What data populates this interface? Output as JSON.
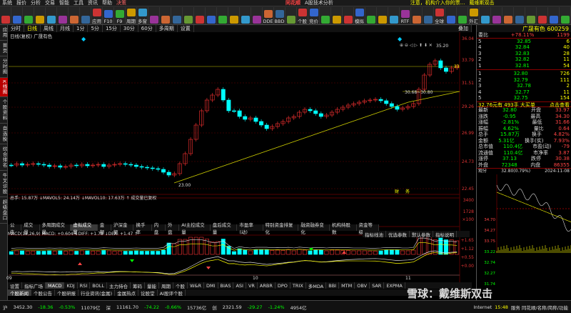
{
  "menu": {
    "items": [
      "系统",
      "报价",
      "分析",
      "交易",
      "智能",
      "工具",
      "资讯",
      "帮助",
      "决策"
    ],
    "brand": "同花顺",
    "subtitle": "A股技术分析",
    "notice": "注意，机构介入你的票...",
    "notice_link": "戴维斯双击"
  },
  "toolbar": {
    "buttons": [
      "",
      "",
      "",
      "",
      "",
      "",
      "",
      "",
      "应用",
      "F10",
      "F9",
      "周期",
      "多窗",
      "",
      "",
      "",
      "",
      "",
      "",
      "",
      "",
      "",
      "",
      "DDE",
      "BBD",
      "",
      "个股",
      "竞价",
      "",
      "",
      "",
      "模拟",
      "",
      "",
      "",
      "RTF",
      "",
      "",
      "全球",
      "",
      "",
      "外汇",
      "",
      "",
      "",
      "",
      "",
      "",
      "",
      ""
    ]
  },
  "sidebar": {
    "items": [
      "应用",
      "首页",
      "分时图",
      "K线图",
      "个股资料",
      "自选股",
      "综合排名",
      "牛叉诊股",
      "超级盘口"
    ],
    "active_index": 3
  },
  "periodbar": {
    "items": [
      "分时",
      "日线",
      "周线",
      "月线",
      "1分",
      "5分",
      "15分",
      "30分",
      "60分",
      "多周期",
      "设置"
    ],
    "selected_index": 1,
    "right_label": "叠加"
  },
  "chart": {
    "header": "日线(复权) 广晟有色",
    "axis_labels": [
      "36.04",
      "33.79",
      "31.51",
      "29.26",
      "26.99",
      "24.73",
      "22.45"
    ],
    "high_label": "35.20",
    "low_label": "23.00",
    "box_label": "30.68~30.80",
    "right_price": "33",
    "events": [
      "财",
      "务"
    ]
  },
  "volume": {
    "label": "总手: 15.87万 ↓MAVOL5: 24.14万 ↓MAVOL10: 17.63万 ↑ 成交量已复权",
    "axis": [
      "3400",
      "1728",
      "×100"
    ]
  },
  "tabs1": {
    "items": [
      "公告",
      "成交量",
      "多周期成交量",
      "虚拟成交量",
      "金额",
      "沪深金额",
      "换手率",
      "内盘",
      "外盘",
      "AI主控成交量",
      "盘后成交量",
      "市盈率(动)",
      "特别资金排复化",
      "融资融券变化",
      "机构持股数",
      "资金等级"
    ],
    "selected_index": 3
  },
  "tabs1b": {
    "items": [
      "指标线池",
      "优选参数",
      "默认参数",
      "指标说明"
    ]
  },
  "macd": {
    "label": "MACD(12,26,9) MACD: +0.604 ↓DIFF: +1.78 ↓DEA: +1.47 ↑",
    "axis": [
      "+1.65",
      "+1.12",
      "+0.55",
      "+0.00"
    ]
  },
  "months": [
    "09",
    "10",
    "11"
  ],
  "tabs2": {
    "items": [
      "设置",
      "指标广场",
      "MACD",
      "KDJ",
      "RSI",
      "BOLL",
      "主力持仓",
      "筹码",
      "量能",
      "周期",
      "个股",
      "W&R",
      "DMI",
      "BIAS",
      "ASI",
      "VR",
      "ARBR",
      "DPO",
      "TRIX",
      "多MDA",
      "BBI",
      "MTM",
      "OBV",
      "SAR",
      "EXPMA"
    ],
    "selected_index": 2
  },
  "tabs3": {
    "items": [
      "个股新闻",
      "个股公告",
      "个股研报",
      "行业资讯(金属)",
      "金属热点",
      "论股堂",
      "AI股评个股"
    ],
    "selected_index": 0
  },
  "right": {
    "title": "广晟有色 600259",
    "weibi_label": "委比",
    "weibi": "+78.11%",
    "weicha": "1199",
    "asks": [
      {
        "l": "5",
        "p": "32.85",
        "v": "6"
      },
      {
        "l": "4",
        "p": "32.84",
        "v": "40"
      },
      {
        "l": "3",
        "p": "32.83",
        "v": "28"
      },
      {
        "l": "2",
        "p": "32.82",
        "v": "11"
      },
      {
        "l": "1",
        "p": "32.81",
        "v": "54"
      }
    ],
    "bids": [
      {
        "l": "1",
        "p": "32.80",
        "v": "726"
      },
      {
        "l": "2",
        "p": "32.79",
        "v": "111"
      },
      {
        "l": "3",
        "p": "32.78",
        "v": "2"
      },
      {
        "l": "4",
        "p": "32.77",
        "v": "11"
      },
      {
        "l": "5",
        "p": "32.75",
        "v": "154"
      }
    ],
    "bigorder": "32.76元有 493手 大买单",
    "bigorder_link": "点击查看",
    "stats": [
      [
        "最新",
        "32.80",
        "开盘",
        "33.97"
      ],
      [
        "涨跌",
        "-0.95",
        "最高",
        "34.30"
      ],
      [
        "涨幅",
        "-2.81%",
        "最低",
        "31.66"
      ],
      [
        "振幅",
        "4.62%",
        "量比",
        "0.64"
      ],
      [
        "总手",
        "15.87万",
        "换手",
        "4.82%"
      ],
      [
        "金额",
        "5.31亿",
        "换手(实)",
        "7.93%"
      ],
      [
        "总市值",
        "110.4亿",
        "市盈(动)",
        "-79"
      ],
      [
        "流通值",
        "110.4亿",
        "市净率",
        "3.87"
      ],
      [
        "涨停",
        "37.13",
        "跌停",
        "30.38"
      ],
      [
        "外盘",
        "72348",
        "内盘",
        "86355"
      ]
    ],
    "mini_label": "观分",
    "mini_price": "32.80(0.79%)",
    "mini_date": "2024-11-08",
    "mini_axis": [
      "34.70",
      "34.27",
      "33.75",
      "33.22",
      "32.74",
      "32.27",
      "31.74"
    ]
  },
  "status": {
    "items": [
      "沪",
      "3452.30",
      "-18.36",
      "-0.53%",
      "11079亿",
      "深",
      "11161.70",
      "-74.22",
      "-0.66%",
      "15736亿",
      "创",
      "2321.59",
      "-29.27",
      "-1.24%",
      "4954亿"
    ],
    "time": "15:48",
    "network": "服务 同花顺/名称/简称/功能",
    "watermark": "雪球：戴维斯双击",
    "net_label": "Internet"
  }
}
